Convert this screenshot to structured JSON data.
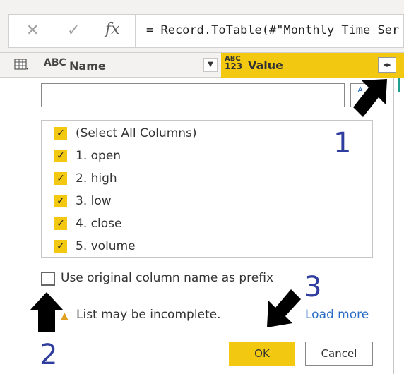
{
  "formula_bar": {
    "cancel_icon": "close-icon",
    "commit_icon": "check-icon",
    "fx_label": "fx",
    "formula": "= Record.ToTable(#\"Monthly Time Ser"
  },
  "columns": {
    "name_type": "ABC",
    "name_label": "Name",
    "value_type_top": "ABC",
    "value_type_bottom": "123",
    "value_label": "Value",
    "accent_color": "#f2c811"
  },
  "dialog": {
    "search_value": "",
    "sort_label_top": "A",
    "sort_label_bottom": "Z",
    "items": [
      {
        "label": "(Select All Columns)",
        "checked": true
      },
      {
        "label": "1. open",
        "checked": true
      },
      {
        "label": "2. high",
        "checked": true
      },
      {
        "label": "3. low",
        "checked": true
      },
      {
        "label": "4. close",
        "checked": true
      },
      {
        "label": "5. volume",
        "checked": true
      }
    ],
    "prefix_label": "Use original column name as prefix",
    "warning": "List may be incomplete.",
    "load_more": "Load more",
    "ok_label": "OK",
    "cancel_label": "Cancel"
  },
  "annotations": {
    "step1": "1",
    "step2": "2",
    "step3": "3"
  }
}
